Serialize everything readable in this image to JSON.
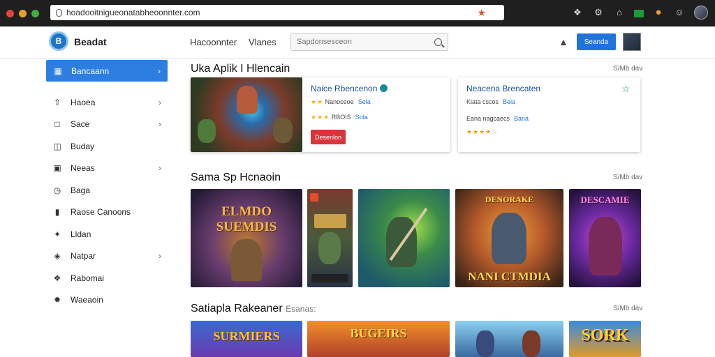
{
  "browser": {
    "url": "hoadooitnigueonatabheoonnter.com",
    "dot_colors": [
      "#e0443a",
      "#e5a12a",
      "#3fae3b"
    ]
  },
  "header": {
    "brand": "Beadat",
    "nav": [
      "Hacoonnter",
      "Vlanes"
    ],
    "search_placeholder": "Sapdonsesceon",
    "sign_in_label": "Seanda"
  },
  "sidebar": {
    "active": {
      "label": "Bancaann",
      "icon": "calendar-icon"
    },
    "items": [
      {
        "label": "Haoea",
        "icon": "upload-icon",
        "chevron": true
      },
      {
        "label": "Sace",
        "icon": "square-icon",
        "chevron": true
      },
      {
        "label": "Buday",
        "icon": "folder-icon",
        "chevron": false
      },
      {
        "label": "Neeas",
        "icon": "gift-icon",
        "chevron": true
      },
      {
        "label": "Baga",
        "icon": "clock-icon",
        "chevron": false
      },
      {
        "label": "Raose Canoons",
        "icon": "bookmark-icon",
        "chevron": false
      },
      {
        "label": "Lldan",
        "icon": "puzzle-icon",
        "chevron": false
      },
      {
        "label": "Natpar",
        "icon": "shield-icon",
        "chevron": true
      },
      {
        "label": "Rabomai",
        "icon": "handshake-icon",
        "chevron": false
      },
      {
        "label": "Waeaoin",
        "icon": "gear-icon",
        "chevron": false
      }
    ]
  },
  "sections": [
    {
      "title": "Uka Aplik I Hlencain",
      "see_all": "S/Mb dav"
    },
    {
      "title": "Sama Sp Hcnaoin",
      "see_all": "S/Mb dav"
    },
    {
      "title": "Satiapla Rakeaner",
      "subtitle": "Esanas:",
      "see_all": "S/Mb dav"
    }
  ],
  "featured": [
    {
      "name": "Naice Rbencenon",
      "meta1": "Nanoceoe",
      "meta1_link": "Sela",
      "meta2": "RBOIS",
      "meta2_link": "Sola",
      "install_label": "Desenlon",
      "rating": 3
    },
    {
      "name": "Neacena Brencaten",
      "meta1": "Kiata cscos",
      "meta1_link": "Beia",
      "meta2": "Eana nagcaecs",
      "meta2_link": "Bana",
      "rating": 4
    }
  ],
  "tiles_row2": [
    {
      "caption": "ELMDO SUEMDIS",
      "accent": "#e0a93a"
    },
    {
      "caption": "",
      "accent": "#e0a93a"
    },
    {
      "caption": "",
      "accent": "#62a84a"
    },
    {
      "caption": "NANI CTMDIA",
      "top": "DENORAKE",
      "accent": "#f0b33a"
    },
    {
      "caption": "",
      "top": "DESCAMIE",
      "accent": "#d64ad0"
    }
  ],
  "tiles_row3": [
    {
      "caption": "SURMIERS"
    },
    {
      "caption": "BUGEIRS"
    },
    {
      "caption": ""
    },
    {
      "caption": "SORK"
    }
  ]
}
